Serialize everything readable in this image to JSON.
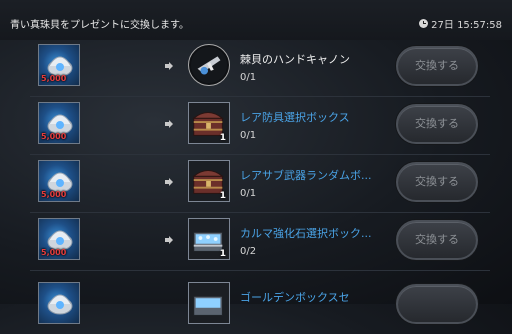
{
  "header": {
    "title": "青い真珠貝をプレゼントに交換します。",
    "time": "27日 15:57:58"
  },
  "rows": [
    {
      "cost": "5,000",
      "name": "棘貝のハンドキャノン",
      "progress": "0/1",
      "count": "",
      "button": "交換する",
      "name_color": "white",
      "reward_icon": "hand-cannon-icon"
    },
    {
      "cost": "5,000",
      "name": "レア防具選択ボックス",
      "progress": "0/1",
      "count": "1",
      "button": "交換する",
      "name_color": "blue",
      "reward_icon": "treasure-chest-icon"
    },
    {
      "cost": "5,000",
      "name": "レアサブ武器ランダムボ...",
      "progress": "0/1",
      "count": "1",
      "button": "交換する",
      "name_color": "blue",
      "reward_icon": "treasure-chest-icon"
    },
    {
      "cost": "5,000",
      "name": "カルマ強化石選択ボック...",
      "progress": "0/2",
      "count": "1",
      "button": "交換する",
      "name_color": "blue",
      "reward_icon": "silver-chest-icon"
    },
    {
      "cost": "",
      "name": "ゴールデンボックスセ",
      "progress": "",
      "count": "",
      "button": "",
      "name_color": "blue",
      "reward_icon": "silver-chest-icon"
    }
  ],
  "colors": {
    "cost_red": "#e33c3c",
    "name_blue": "#4aa3e6"
  }
}
